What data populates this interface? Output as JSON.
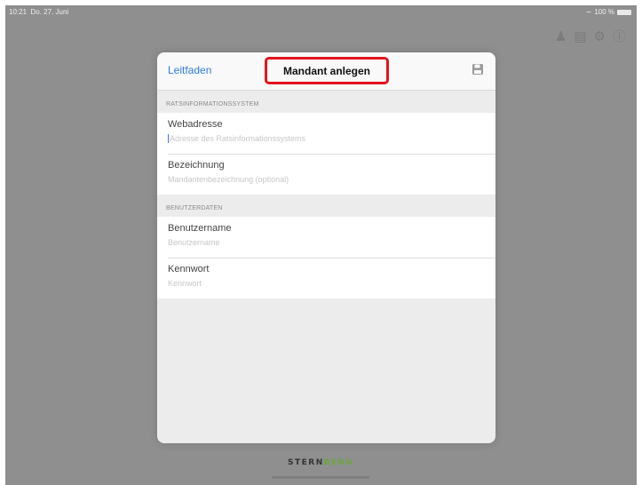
{
  "status_bar": {
    "time": "10:21",
    "date": "Do. 27. Juni",
    "battery": "100 %",
    "wifi_icon": "wifi-icon",
    "battery_icon": "battery-icon"
  },
  "toolbar_icons": [
    "person-icon",
    "document-icon",
    "gear-icon",
    "help-icon"
  ],
  "modal": {
    "back_label": "Leitfaden",
    "title": "Mandant anlegen",
    "save_icon": "floppy-disk-icon",
    "highlight_color": "#e1141c",
    "accent_color": "#2f7be0",
    "sections": [
      {
        "header": "RATSINFORMATIONSSYSTEM",
        "fields": [
          {
            "label": "Webadresse",
            "placeholder": "Adresse des Ratsinformationssystems",
            "value": ""
          },
          {
            "label": "Bezeichnung",
            "placeholder": "Mandantenbezeichnung (optional)",
            "value": ""
          }
        ]
      },
      {
        "header": "BENUTZERDATEN",
        "fields": [
          {
            "label": "Benutzername",
            "placeholder": "Benutzername",
            "value": ""
          },
          {
            "label": "Kennwort",
            "placeholder": "Kennwort",
            "value": ""
          }
        ]
      }
    ]
  },
  "footer": {
    "logo_part1": "STERN",
    "logo_part2": "BERG"
  }
}
